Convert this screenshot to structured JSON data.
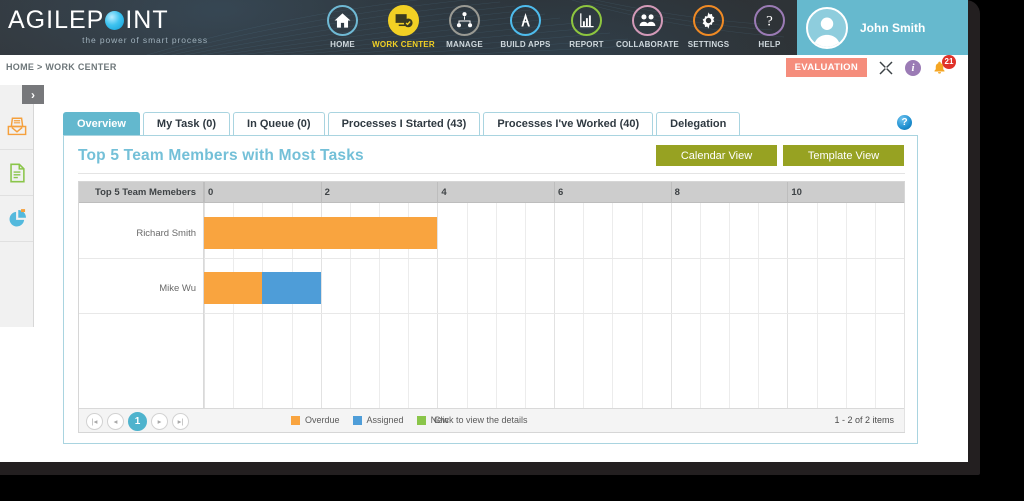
{
  "header": {
    "logo_text_a": "AGILEP",
    "logo_text_b": "INT",
    "logo_tagline": "the power of smart process",
    "nav": [
      {
        "label": "HOME",
        "icon": "home-icon",
        "color": "#6fb9d4",
        "active": false
      },
      {
        "label": "WORK CENTER",
        "icon": "monitor-check-icon",
        "color": "#f2d024",
        "active": true
      },
      {
        "label": "MANAGE",
        "icon": "org-chart-icon",
        "color": "#9a9a93",
        "active": false
      },
      {
        "label": "BUILD APPS",
        "icon": "compass-icon",
        "color": "#4ebced",
        "active": false
      },
      {
        "label": "REPORT",
        "icon": "bar-chart-icon",
        "color": "#8ec63f",
        "active": false
      },
      {
        "label": "COLLABORATE",
        "icon": "people-icon",
        "color": "#d39ab8",
        "active": false
      },
      {
        "label": "SETTINGS",
        "icon": "gear-icon",
        "color": "#f08a24",
        "active": false
      },
      {
        "label": "HELP",
        "icon": "question-icon",
        "color": "#9b7bb5",
        "active": false
      }
    ],
    "user_name": "John Smith"
  },
  "toolbar": {
    "breadcrumb": "HOME > WORK CENTER",
    "evaluation_badge": "EVALUATION",
    "notification_count": "21"
  },
  "sidebar": {
    "toggle_glyph": "›",
    "items": [
      {
        "name": "inbox-tray-icon",
        "color": "#f5a03c"
      },
      {
        "name": "document-icon",
        "color": "#8ac54a"
      },
      {
        "name": "pie-chart-icon",
        "color": "#53b9dd"
      }
    ]
  },
  "tabs": [
    {
      "label": "Overview",
      "active": true
    },
    {
      "label": "My Task (0)",
      "active": false
    },
    {
      "label": "In Queue (0)",
      "active": false
    },
    {
      "label": "Processes I Started (43)",
      "active": false
    },
    {
      "label": "Processes I've Worked (40)",
      "active": false
    },
    {
      "label": "Delegation",
      "active": false
    }
  ],
  "tab_help_glyph": "?",
  "panel": {
    "title": "Top 5 Team Members with Most Tasks",
    "buttons": [
      {
        "label": "Calendar View"
      },
      {
        "label": "Template View"
      }
    ]
  },
  "footer": {
    "pager": [
      {
        "glyph": "|◂",
        "name": "first-page-button",
        "current": false
      },
      {
        "glyph": "◂",
        "name": "prev-page-button",
        "current": false
      },
      {
        "glyph": "1",
        "name": "page-1-button",
        "current": true
      },
      {
        "glyph": "▸",
        "name": "next-page-button",
        "current": false
      },
      {
        "glyph": "▸|",
        "name": "last-page-button",
        "current": false
      }
    ],
    "hint": "Click to view the details",
    "item_range": "1 - 2 of 2 items"
  },
  "chart_data": {
    "type": "bar",
    "orientation": "horizontal",
    "stacked": true,
    "title": "Top 5 Team Members with Most Tasks",
    "row_header": "Top 5 Team Memebers",
    "xlabel": "",
    "ylabel": "",
    "xlim": [
      0,
      12
    ],
    "xticks": [
      0,
      2,
      4,
      6,
      8,
      10
    ],
    "minor_tick_step": 0.5,
    "grid": true,
    "legend_position": "bottom",
    "categories": [
      "Richard Smith",
      "Mike Wu"
    ],
    "series": [
      {
        "name": "Overdue",
        "color": "#f9a43f",
        "values": [
          4,
          1
        ]
      },
      {
        "name": "Assigned",
        "color": "#4e9dd8",
        "values": [
          0,
          1
        ]
      },
      {
        "name": "New",
        "color": "#8ac54a",
        "values": [
          0,
          0
        ]
      }
    ],
    "totals": [
      4,
      2
    ]
  }
}
